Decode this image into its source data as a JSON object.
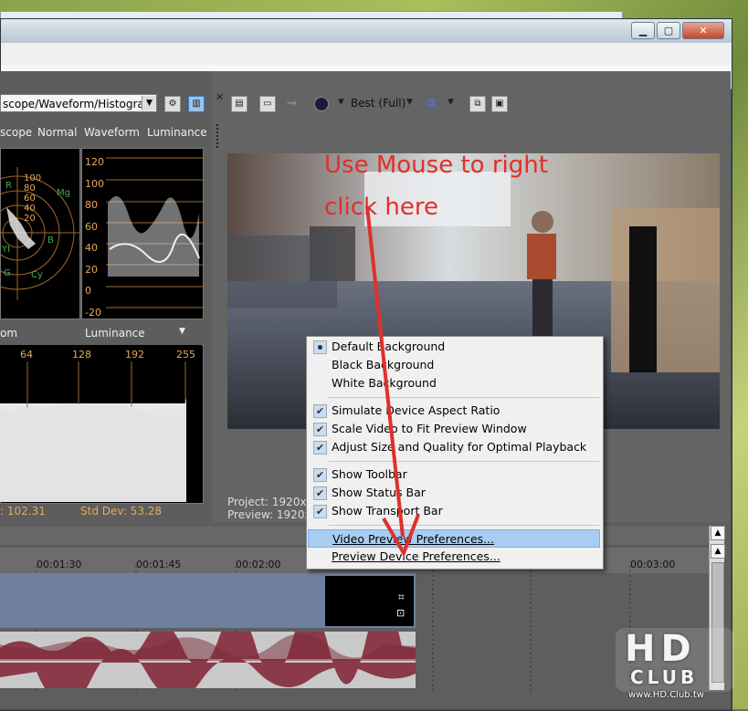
{
  "scope": {
    "dropdown_value": "scope/Waveform/Histogram",
    "tabs": [
      "scope",
      "Normal",
      "Waveform",
      "Luminance"
    ],
    "vectorscope_ticks": [
      "100",
      "80",
      "60",
      "40",
      "20"
    ],
    "vectorscope_markers": [
      "R",
      "Mg",
      "YI",
      "B",
      "Cy",
      "G"
    ],
    "waveform_ticks": [
      "120",
      "100",
      "80",
      "60",
      "40",
      "20",
      "0",
      "-20"
    ],
    "histogram_label_left": "om",
    "histogram_channel": "Luminance",
    "histogram_ticks": [
      "64",
      "128",
      "192",
      "255"
    ],
    "stat_mean": ": 102.31",
    "stat_stddev": "Std Dev: 53.28"
  },
  "preview": {
    "quality": "Best (Full)",
    "info_project": "Project:  1920x",
    "info_preview": "Preview:  1920x"
  },
  "annotation": {
    "line1": "Use Mouse to right",
    "line2": "click here"
  },
  "context_menu": {
    "group1": [
      {
        "label": "Default Background",
        "state": "radio"
      },
      {
        "label": "Black Background",
        "state": "none"
      },
      {
        "label": "White Background",
        "state": "none"
      }
    ],
    "group2": [
      {
        "label": "Simulate Device Aspect Ratio",
        "state": "checked"
      },
      {
        "label": "Scale Video to Fit Preview Window",
        "state": "checked"
      },
      {
        "label": "Adjust Size and Quality for Optimal Playback",
        "state": "checked"
      }
    ],
    "group3": [
      {
        "label": "Show Toolbar",
        "state": "checked"
      },
      {
        "label": "Show Status Bar",
        "state": "checked"
      },
      {
        "label": "Show Transport Bar",
        "state": "checked"
      }
    ],
    "group4": [
      {
        "label": "Video Preview Preferences...",
        "state": "highlighted"
      },
      {
        "label": "Preview Device Preferences...",
        "state": "none"
      }
    ]
  },
  "timeline": {
    "timecodes": [
      "00:01:30",
      "00:01:45",
      "00:02:00",
      "00:03:00"
    ]
  },
  "watermark": {
    "logo_top": "HD",
    "logo_bottom": "CLUB",
    "url": "www.HD.Club.tw"
  },
  "colors": {
    "annotation": "#e0302a",
    "menu_highlight": "#a9cdf2",
    "scope_ticks": "#e8a85a",
    "audio_wave": "#8a3a48"
  }
}
